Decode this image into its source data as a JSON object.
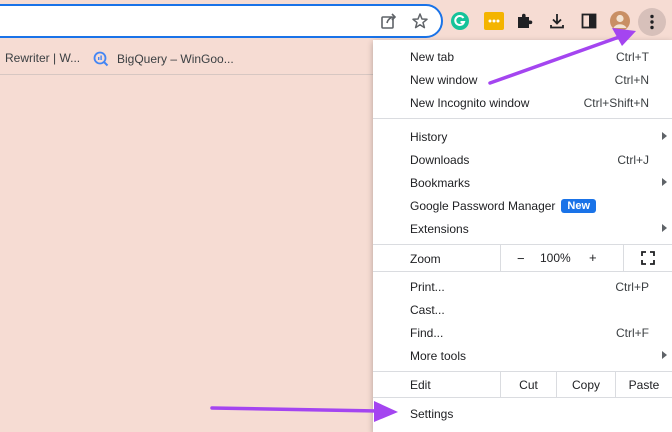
{
  "bookmarks": [
    {
      "label": "Rewriter | W..."
    },
    {
      "label": "BigQuery – WinGoo..."
    }
  ],
  "toolbar_icons": [
    "share-icon",
    "star-icon",
    "grammarly-icon",
    "extension-yellow-icon",
    "puzzle-icon",
    "download-icon",
    "side-panel-icon",
    "avatar",
    "more-vert-icon"
  ],
  "menu": {
    "new_tab": {
      "label": "New tab",
      "shortcut": "Ctrl+T"
    },
    "new_window": {
      "label": "New window",
      "shortcut": "Ctrl+N"
    },
    "new_incognito": {
      "label": "New Incognito window",
      "shortcut": "Ctrl+Shift+N"
    },
    "history": {
      "label": "History"
    },
    "downloads": {
      "label": "Downloads",
      "shortcut": "Ctrl+J"
    },
    "bookmarks": {
      "label": "Bookmarks"
    },
    "password_manager": {
      "label": "Google Password Manager",
      "badge": "New"
    },
    "extensions": {
      "label": "Extensions"
    },
    "zoom": {
      "label": "Zoom",
      "minus": "−",
      "value": "100%",
      "plus": "+"
    },
    "print": {
      "label": "Print...",
      "shortcut": "Ctrl+P"
    },
    "cast": {
      "label": "Cast..."
    },
    "find": {
      "label": "Find...",
      "shortcut": "Ctrl+F"
    },
    "more_tools": {
      "label": "More tools"
    },
    "edit": {
      "label": "Edit",
      "cut": "Cut",
      "copy": "Copy",
      "paste": "Paste"
    },
    "settings": {
      "label": "Settings"
    }
  },
  "colors": {
    "accent": "#1a73e8",
    "background": "#f6dcd3",
    "annotation_arrow": "#a445f0"
  }
}
